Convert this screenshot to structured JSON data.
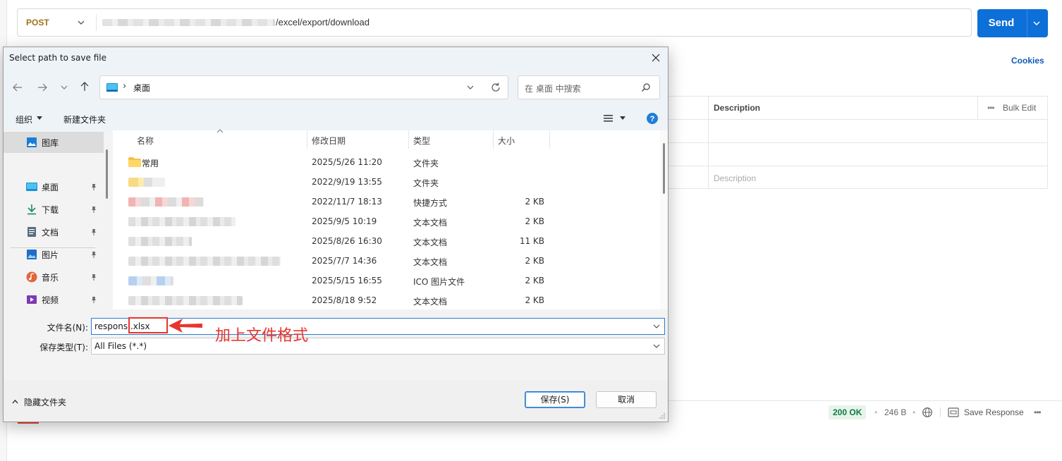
{
  "request": {
    "method": "POST",
    "url_suffix": "/excel/export/download",
    "send_label": "Send",
    "cookies_label": "Cookies"
  },
  "params_table": {
    "description_header": "Description",
    "bulk_edit_label": "Bulk Edit",
    "description_placeholder": "Description"
  },
  "response": {
    "status": "200 OK",
    "size": "246 B",
    "save_label": "Save Response"
  },
  "dialog": {
    "title": "Select path to save file",
    "address": "桌面",
    "search_placeholder": "在 桌面 中搜索",
    "organize_label": "组织",
    "new_folder_label": "新建文件夹",
    "nav_items": [
      {
        "label": "图库",
        "icon": "gallery-icon",
        "pinned": false
      },
      {
        "label": "桌面",
        "icon": "desktop-icon",
        "pinned": true
      },
      {
        "label": "下载",
        "icon": "download-icon",
        "pinned": true
      },
      {
        "label": "文档",
        "icon": "document-icon",
        "pinned": true
      },
      {
        "label": "图片",
        "icon": "picture-icon",
        "pinned": true
      },
      {
        "label": "音乐",
        "icon": "music-icon",
        "pinned": true
      },
      {
        "label": "视频",
        "icon": "video-icon",
        "pinned": true
      }
    ],
    "columns": {
      "name": "名称",
      "modified": "修改日期",
      "type": "类型",
      "size": "大小"
    },
    "files": [
      {
        "name": "常用",
        "modified": "2025/5/26 11:20",
        "type": "文件夹",
        "size": "",
        "icon": "folder-icon"
      },
      {
        "name": "",
        "modified": "2022/9/19 13:55",
        "type": "文件夹",
        "size": "",
        "icon": "folder-icon"
      },
      {
        "name": "",
        "modified": "2022/11/7 18:13",
        "type": "快捷方式",
        "size": "2 KB",
        "icon": "shortcut-icon"
      },
      {
        "name": "",
        "modified": "2025/9/5 10:19",
        "type": "文本文档",
        "size": "2 KB",
        "icon": "text-file-icon"
      },
      {
        "name": "",
        "modified": "2025/8/26 16:30",
        "type": "文本文档",
        "size": "11 KB",
        "icon": "text-file-icon"
      },
      {
        "name": "",
        "modified": "2025/7/7 14:36",
        "type": "文本文档",
        "size": "2 KB",
        "icon": "text-file-icon"
      },
      {
        "name": "",
        "modified": "2025/5/15 16:55",
        "type": "ICO 图片文件",
        "size": "2 KB",
        "icon": "image-file-icon"
      },
      {
        "name": "",
        "modified": "2025/8/18 9:52",
        "type": "文本文档",
        "size": "2 KB",
        "icon": "text-file-icon"
      }
    ],
    "filename_label": "文件名(N):",
    "filename_value": "respons .xlsx",
    "filetype_label": "保存类型(T):",
    "filetype_value": "All Files (*.*)",
    "hide_folders_label": "隐藏文件夹",
    "save_label": "保存(S)",
    "cancel_label": "取消"
  },
  "annotation": {
    "text": "加上文件格式",
    "color": "#e8352e"
  }
}
